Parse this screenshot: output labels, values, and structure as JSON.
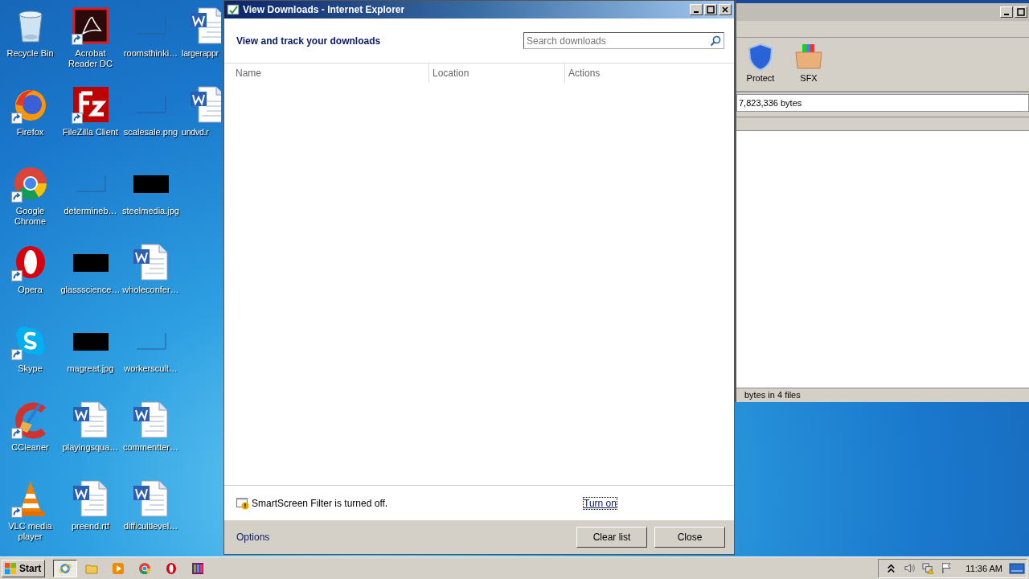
{
  "desktop_icons": [
    {
      "label": "Recycle Bin",
      "kind": "recycle",
      "shortcut": false
    },
    {
      "label": "Firefox",
      "kind": "firefox",
      "shortcut": true
    },
    {
      "label": "Google Chrome",
      "kind": "chrome",
      "shortcut": true
    },
    {
      "label": "Opera",
      "kind": "opera",
      "shortcut": true
    },
    {
      "label": "Skype",
      "kind": "skype",
      "shortcut": true
    },
    {
      "label": "CCleaner",
      "kind": "ccleaner",
      "shortcut": true
    },
    {
      "label": "VLC media player",
      "kind": "vlc",
      "shortcut": true
    },
    {
      "label": "Acrobat Reader DC",
      "kind": "acrobat",
      "shortcut": true
    },
    {
      "label": "FileZilla Client",
      "kind": "filezilla",
      "shortcut": true
    },
    {
      "label": "determineb…",
      "kind": "blank",
      "shortcut": false
    },
    {
      "label": "glassscience…",
      "kind": "image",
      "shortcut": false
    },
    {
      "label": "magreat.jpg",
      "kind": "image",
      "shortcut": false
    },
    {
      "label": "playingsqua…",
      "kind": "word",
      "shortcut": false
    },
    {
      "label": "preend.rtf",
      "kind": "word",
      "shortcut": false
    },
    {
      "label": "roomsthinki…",
      "kind": "blank",
      "shortcut": false
    },
    {
      "label": "scalesale.png",
      "kind": "blank",
      "shortcut": false
    },
    {
      "label": "steelmedia.jpg",
      "kind": "image",
      "shortcut": false
    },
    {
      "label": "wholeconfer…",
      "kind": "word",
      "shortcut": false
    },
    {
      "label": "workerscult…",
      "kind": "blank",
      "shortcut": false
    },
    {
      "label": "commentter…",
      "kind": "word",
      "shortcut": false
    },
    {
      "label": "difficultlevel…",
      "kind": "word",
      "shortcut": false
    },
    {
      "label": "largerappr",
      "kind": "word",
      "shortcut": false
    },
    {
      "label": "undvd.r",
      "kind": "word",
      "shortcut": false
    }
  ],
  "downloads_window": {
    "title": "View Downloads - Internet Explorer",
    "heading": "View and track your downloads",
    "search": {
      "placeholder": "Search downloads"
    },
    "columns": [
      "Name",
      "Location",
      "Actions"
    ],
    "smartscreen": {
      "message": "SmartScreen Filter is turned off.",
      "link": "Turn on"
    },
    "options_link": "Options",
    "buttons": [
      "Clear list",
      "Close"
    ]
  },
  "archive_window": {
    "toolbar": [
      {
        "label": "Protect",
        "kind": "shield"
      },
      {
        "label": "SFX",
        "kind": "box"
      }
    ],
    "address": "7,823,336 bytes",
    "status": "bytes in 4 files"
  },
  "taskbar": {
    "start": "Start",
    "apps": [
      {
        "kind": "ie",
        "selected": true
      },
      {
        "kind": "folder",
        "selected": false
      },
      {
        "kind": "media",
        "selected": false
      },
      {
        "kind": "chrome",
        "selected": false
      },
      {
        "kind": "opera",
        "selected": false
      },
      {
        "kind": "winrar",
        "selected": false
      }
    ],
    "clock": "11:36 AM"
  }
}
